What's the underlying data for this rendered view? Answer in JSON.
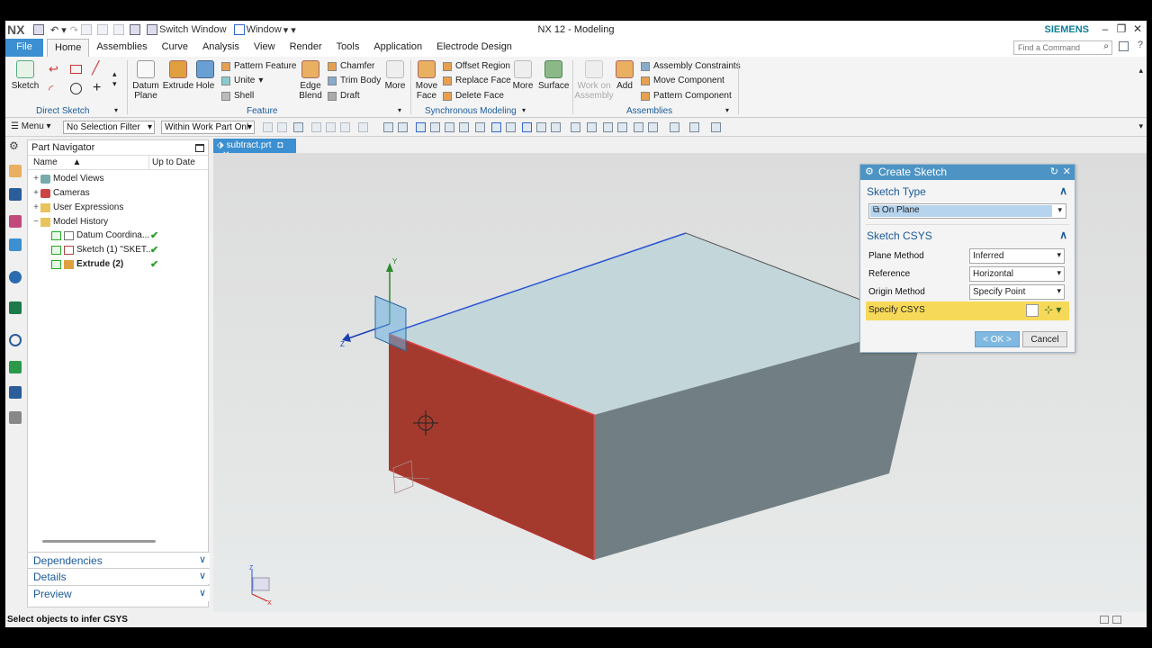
{
  "titlebar": {
    "logo": "NX",
    "switch_window": "Switch Window",
    "window": "Window",
    "title": "NX 12 - Modeling",
    "brand": "SIEMENS"
  },
  "menu": {
    "tabs": [
      "File",
      "Home",
      "Assemblies",
      "Curve",
      "Analysis",
      "View",
      "Render",
      "Tools",
      "Application",
      "Electrode Design"
    ],
    "active": "Home",
    "find_placeholder": "Find a Command"
  },
  "ribbon": {
    "direct_sketch": {
      "sketch": "Sketch",
      "group": "Direct Sketch"
    },
    "feature": {
      "datum_plane": "Datum\nPlane",
      "extrude": "Extrude",
      "hole": "Hole",
      "pattern_feature": "Pattern Feature",
      "unite": "Unite",
      "shell": "Shell",
      "edge_blend": "Edge\nBlend",
      "chamfer": "Chamfer",
      "trim_body": "Trim Body",
      "draft": "Draft",
      "more": "More",
      "group": "Feature"
    },
    "synchronous": {
      "move_face": "Move\nFace",
      "offset_region": "Offset Region",
      "replace_face": "Replace Face",
      "delete_face": "Delete Face",
      "more": "More",
      "surface": "Surface",
      "group": "Synchronous Modeling"
    },
    "assemblies": {
      "work_on": "Work on\nAssembly",
      "add": "Add",
      "assembly_constraints": "Assembly Constraints",
      "move_component": "Move Component",
      "pattern_component": "Pattern Component",
      "group": "Assemblies"
    }
  },
  "toolbar": {
    "menu": "Menu",
    "selection_filter": "No Selection Filter",
    "scope": "Within Work Part Onl"
  },
  "navigator": {
    "title": "Part Navigator",
    "col_name": "Name",
    "col_uptodate": "Up to Date",
    "items": [
      {
        "label": "Model Views",
        "indent": 0,
        "check": ""
      },
      {
        "label": "Cameras",
        "indent": 0,
        "check": ""
      },
      {
        "label": "User Expressions",
        "indent": 0,
        "check": ""
      },
      {
        "label": "Model History",
        "indent": 0,
        "check": ""
      },
      {
        "label": "Datum Coordina...",
        "indent": 1,
        "check": "✔"
      },
      {
        "label": "Sketch (1) \"SKET...",
        "indent": 1,
        "check": "✔"
      },
      {
        "label": "Extrude (2)",
        "indent": 1,
        "check": "✔"
      }
    ],
    "panels": [
      "Dependencies",
      "Details",
      "Preview"
    ]
  },
  "graphics": {
    "tab": "subtract.prt",
    "axis_y": "Y",
    "axis_z": "Z",
    "triad_z": "Z",
    "triad_x": "X",
    "triad_y": "Y"
  },
  "dialog": {
    "title": "Create Sketch",
    "sketch_type": "Sketch Type",
    "type_value": "On Plane",
    "sketch_csys": "Sketch CSYS",
    "plane_method": "Plane Method",
    "plane_method_value": "Inferred",
    "reference": "Reference",
    "reference_value": "Horizontal",
    "origin_method": "Origin Method",
    "origin_method_value": "Specify Point",
    "specify_csys": "Specify CSYS",
    "ok": "< OK >",
    "cancel": "Cancel"
  },
  "status": {
    "text": "Select objects to infer CSYS"
  },
  "colors": {
    "accent": "#3c8fd0",
    "face_red": "#a33a2d",
    "box_top": "#c3d6da",
    "box_front": "#717f84",
    "highlight": "#f7d95a"
  }
}
